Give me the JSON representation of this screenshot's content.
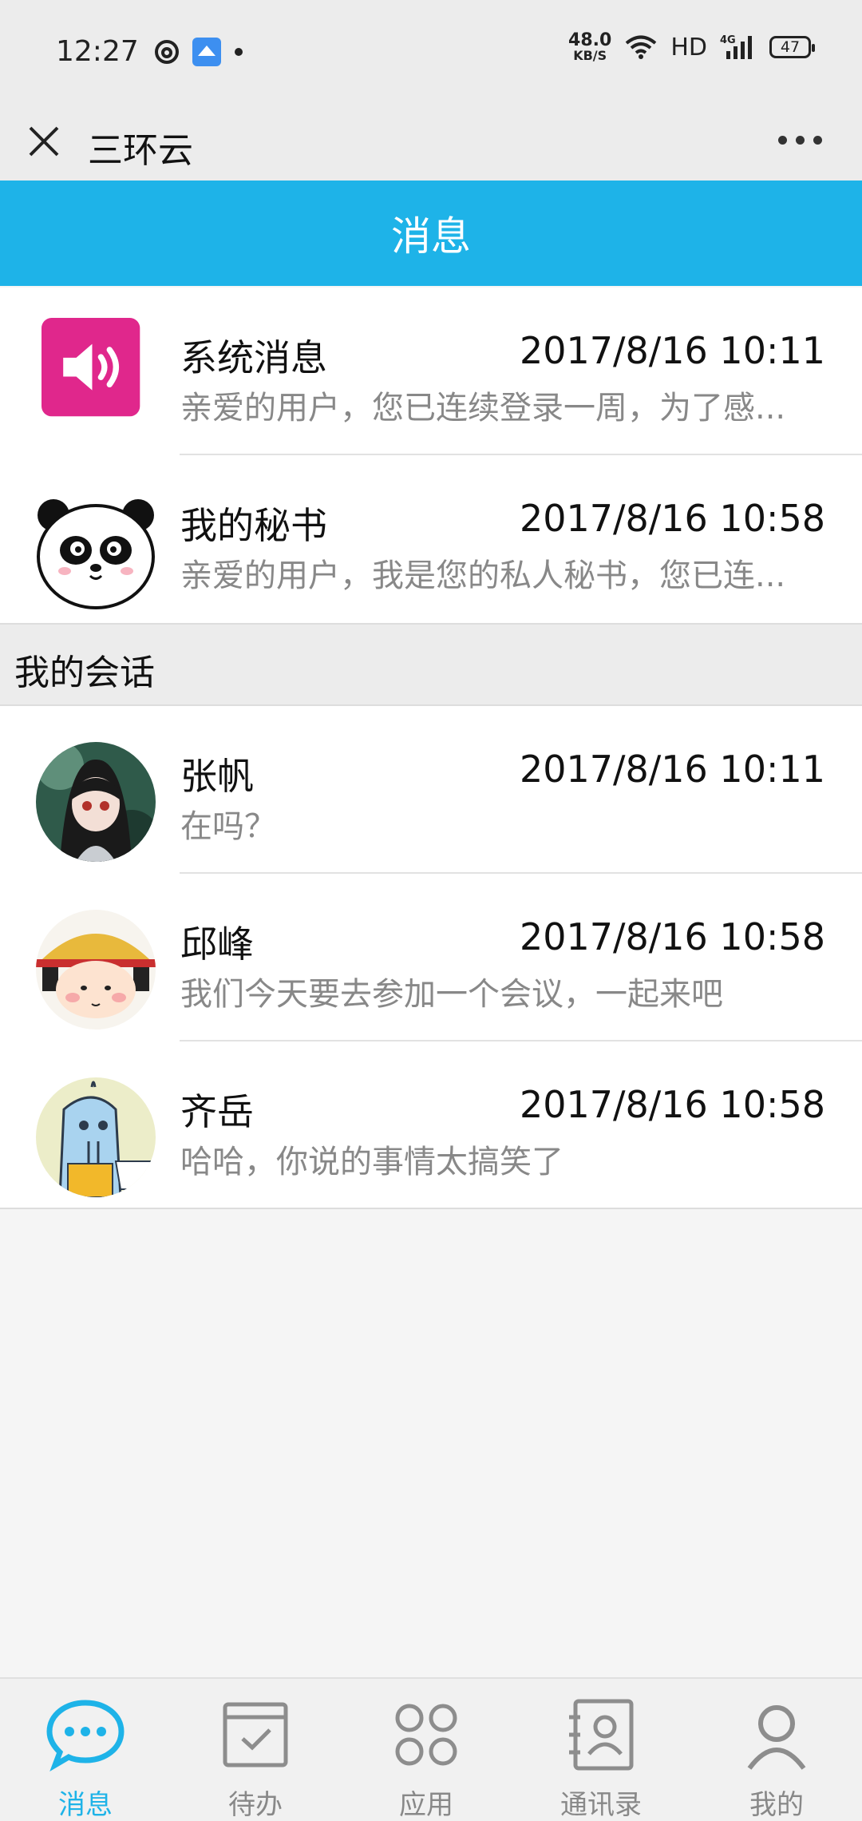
{
  "status_bar": {
    "time": "12:27",
    "net_speed": "48.0",
    "net_unit": "KB/S",
    "hd": "HD",
    "network": "4G",
    "battery": "47"
  },
  "nav": {
    "title": "三环云"
  },
  "header": {
    "title": "消息"
  },
  "system_items": [
    {
      "name": "系统消息",
      "time": "2017/8/16 10:11",
      "message": "亲爱的用户，您已连续登录一周，为了感...",
      "avatar_icon": "speaker-icon"
    },
    {
      "name": "我的秘书",
      "time": "2017/8/16 10:58",
      "message": "亲爱的用户，我是您的私人秘书，您已连...",
      "avatar_icon": "panda-avatar"
    }
  ],
  "section": {
    "title": "我的会话"
  },
  "conversations": [
    {
      "name": "张帆",
      "time": "2017/8/16 10:11",
      "message": "在吗？"
    },
    {
      "name": "邱峰",
      "time": "2017/8/16 10:58",
      "message": "我们今天要去参加一个会议，一起来吧"
    },
    {
      "name": "齐岳",
      "time": "2017/8/16 10:58",
      "message": "哈哈，你说的事情太搞笑了"
    }
  ],
  "tabs": [
    {
      "label": "消息",
      "icon": "chat-bubble-icon",
      "active": true
    },
    {
      "label": "待办",
      "icon": "todo-check-icon",
      "active": false
    },
    {
      "label": "应用",
      "icon": "apps-grid-icon",
      "active": false
    },
    {
      "label": "通讯录",
      "icon": "contacts-book-icon",
      "active": false
    },
    {
      "label": "我的",
      "icon": "person-icon",
      "active": false
    }
  ],
  "colors": {
    "accent": "#1eb3e8",
    "system_icon_bg": "#e0278c"
  }
}
